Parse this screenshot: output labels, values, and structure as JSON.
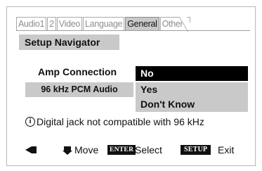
{
  "tabs": [
    {
      "label": "Audio1",
      "active": false
    },
    {
      "label": "2",
      "active": false
    },
    {
      "label": "Video",
      "active": false
    },
    {
      "label": "Language",
      "active": false
    },
    {
      "label": "General",
      "active": true
    },
    {
      "label": "Other",
      "active": false
    }
  ],
  "title": "Setup Navigator",
  "setting": {
    "label": "Amp Connection",
    "sub_label": "96 kHz PCM Audio"
  },
  "options": [
    {
      "label": "No",
      "selected": true
    },
    {
      "label": "Yes",
      "selected": false
    },
    {
      "label": "Don't Know",
      "selected": false
    }
  ],
  "info": {
    "icon": "info-icon",
    "glyph": "i",
    "text": "Digital jack not compatible with 96 kHz"
  },
  "footer": {
    "back_icon": "back-arrow-icon",
    "move_icon": "down-arrow-icon",
    "move_label": "Move",
    "enter_key": "ENTER",
    "select_label": "Select",
    "setup_key": "SETUP",
    "exit_label": "Exit"
  },
  "colors": {
    "highlight": "#000000",
    "panel_gray": "#c9c9c9",
    "inactive_tab_text": "#8e8e8e"
  }
}
